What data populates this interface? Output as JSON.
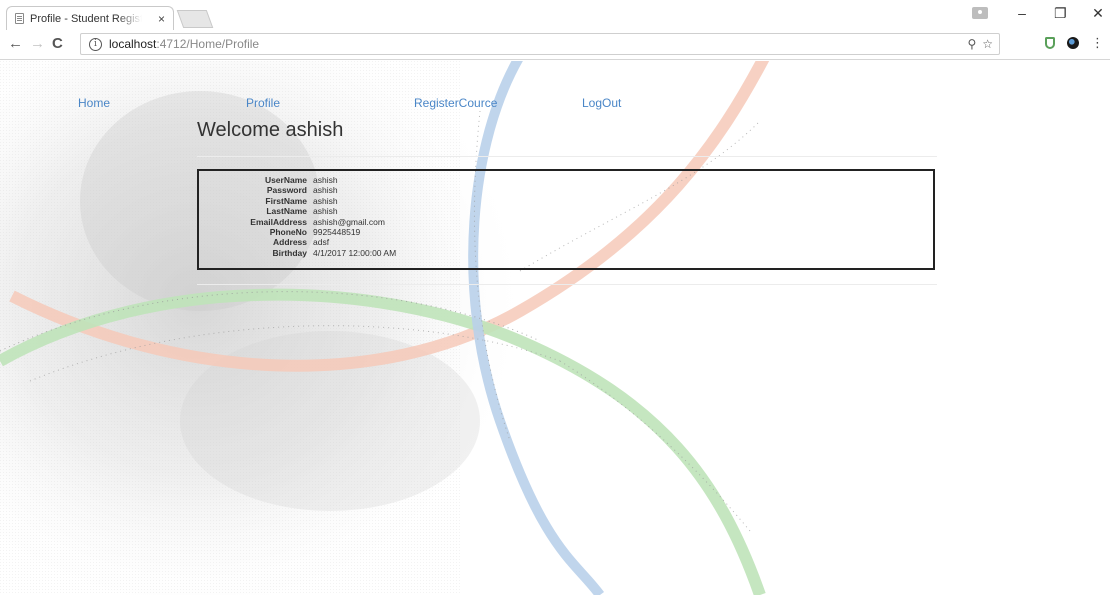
{
  "browser": {
    "tab_title": "Profile - Student Registra",
    "tab_close": "×",
    "url_host": "localhost",
    "url_path": ":4712/Home/Profile",
    "info_icon": "i",
    "nav": {
      "back": "←",
      "forward": "→",
      "reload": "C"
    },
    "window": {
      "minimize": "–",
      "restore": "❐",
      "close": "✕"
    },
    "omnibox_icons": {
      "zoom": "⚲",
      "star": "☆"
    },
    "menu": "⋮"
  },
  "nav_links": [
    {
      "label": "Home"
    },
    {
      "label": "Profile"
    },
    {
      "label": "RegisterCource"
    },
    {
      "label": "LogOut"
    }
  ],
  "welcome": "Welcome ashish",
  "profile": [
    {
      "label": "UserName",
      "value": "ashish"
    },
    {
      "label": "Password",
      "value": "ashish"
    },
    {
      "label": "FirstName",
      "value": "ashish"
    },
    {
      "label": "LastName",
      "value": "ashish"
    },
    {
      "label": "EmailAddress",
      "value": "ashish@gmail.com"
    },
    {
      "label": "PhoneNo",
      "value": "9925448519"
    },
    {
      "label": "Address",
      "value": "adsf"
    },
    {
      "label": "Birthday",
      "value": "4/1/2017 12:00:00 AM"
    }
  ],
  "colors": {
    "link": "#4a86c7",
    "arc_blue": "#b9d0ea",
    "arc_green": "#bfe3b9",
    "arc_orange": "#f6c9b8"
  },
  "icons": [
    "page-favicon-icon",
    "close-icon",
    "back-arrow-icon",
    "forward-arrow-icon",
    "reload-icon",
    "info-icon",
    "zoom-icon",
    "star-icon",
    "extension-shield-icon",
    "extension-circle-icon",
    "menu-icon"
  ]
}
